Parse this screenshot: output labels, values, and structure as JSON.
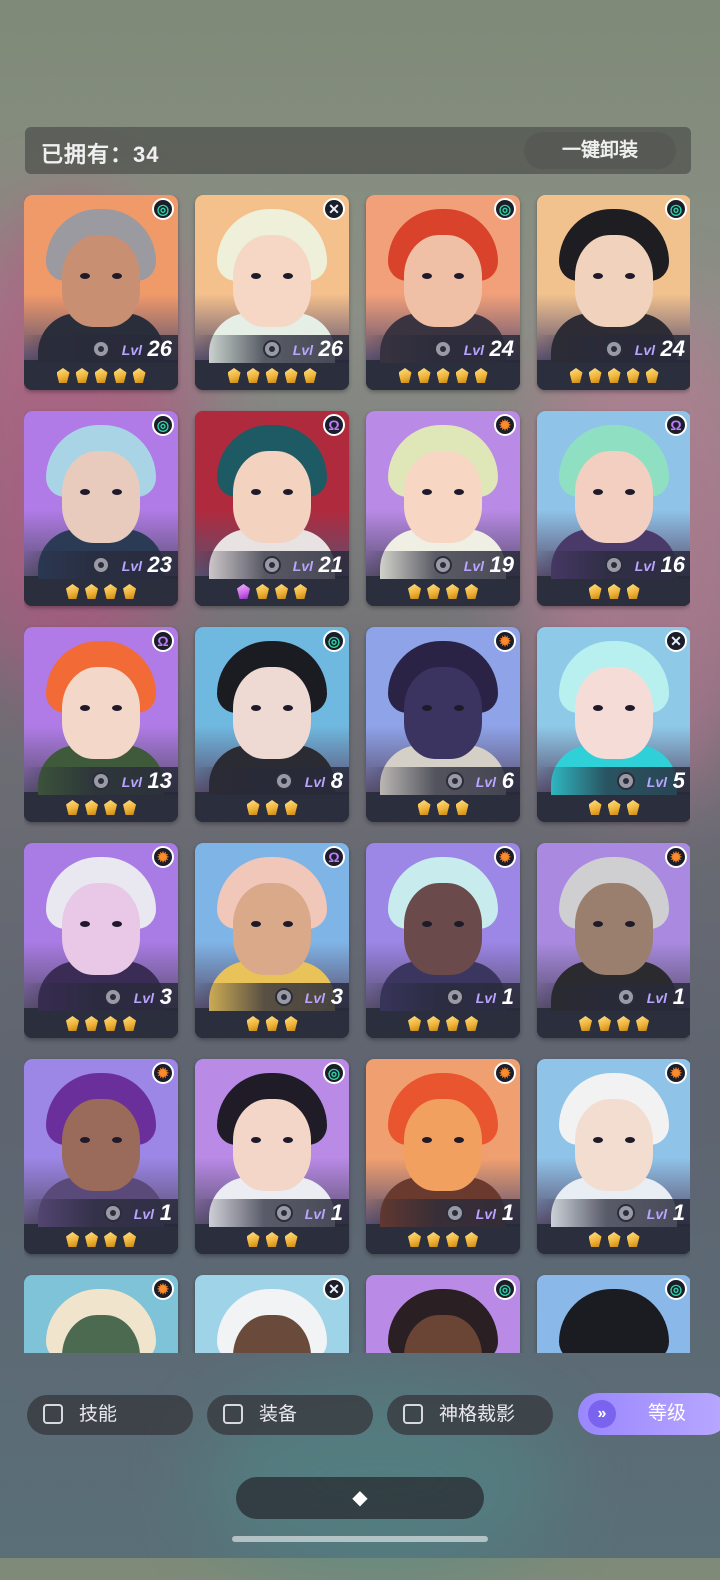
{
  "header": {
    "owned_label": "已拥有：34",
    "unequip_label": "一键卸装"
  },
  "characters": [
    {
      "level": "26",
      "gems": 5,
      "purple": 0,
      "badge": "spiral",
      "badge_color": "#2fd3a8",
      "bg": "#f09a6a",
      "hair": "#9a9aa0",
      "skin": "#c98f72",
      "outfit": "#2a2d3a"
    },
    {
      "level": "26",
      "gems": 5,
      "purple": 0,
      "badge": "cross",
      "badge_color": "#e8f0ff",
      "bg": "#f4c08c",
      "hair": "#eef0da",
      "skin": "#f6d7c6",
      "outfit": "#e5efe6"
    },
    {
      "level": "24",
      "gems": 5,
      "purple": 0,
      "badge": "spiral",
      "badge_color": "#2fd3a8",
      "bg": "#f2a07a",
      "hair": "#d9432b",
      "skin": "#f0c0a6",
      "outfit": "#3a3440"
    },
    {
      "level": "24",
      "gems": 5,
      "purple": 0,
      "badge": "spiral",
      "badge_color": "#2fd3a8",
      "bg": "#f2c28e",
      "hair": "#1e1d22",
      "skin": "#f0d2bd",
      "outfit": "#2d2c35"
    },
    {
      "level": "23",
      "gems": 4,
      "purple": 0,
      "badge": "spiral",
      "badge_color": "#2fd3a8",
      "bg": "#b07be6",
      "hair": "#a9d4e6",
      "skin": "#e8cbbd",
      "outfit": "#2b3a55"
    },
    {
      "level": "21",
      "gems": 3,
      "purple": 1,
      "badge": "omega",
      "badge_color": "#c07cff",
      "bg": "#b02a3e",
      "hair": "#1d5a63",
      "skin": "#f3d2c0",
      "outfit": "#e9e2e2"
    },
    {
      "level": "19",
      "gems": 4,
      "purple": 0,
      "badge": "sun",
      "badge_color": "#ff8a2a",
      "bg": "#b98ae6",
      "hair": "#dfe6b8",
      "skin": "#f7d6c4",
      "outfit": "#f0efe4"
    },
    {
      "level": "16",
      "gems": 3,
      "purple": 0,
      "badge": "omega",
      "badge_color": "#c07cff",
      "bg": "#8fc3e8",
      "hair": "#8fe0c2",
      "skin": "#f2cfc0",
      "outfit": "#4a3a6a"
    },
    {
      "level": "13",
      "gems": 4,
      "purple": 0,
      "badge": "omega",
      "badge_color": "#c07cff",
      "bg": "#b07be6",
      "hair": "#f26a35",
      "skin": "#f3d7c8",
      "outfit": "#3f5a3a"
    },
    {
      "level": "8",
      "gems": 3,
      "purple": 0,
      "badge": "spiral",
      "badge_color": "#2fd3a8",
      "bg": "#6fb8e0",
      "hair": "#1b1b22",
      "skin": "#eed9d3",
      "outfit": "#2b2b33"
    },
    {
      "level": "6",
      "gems": 3,
      "purple": 0,
      "badge": "sun",
      "badge_color": "#ff8a2a",
      "bg": "#8ea3e8",
      "hair": "#2a2345",
      "skin": "#3b3360",
      "outfit": "#d4d0c8"
    },
    {
      "level": "5",
      "gems": 3,
      "purple": 0,
      "badge": "cross",
      "badge_color": "#e8f0ff",
      "bg": "#8fc9e8",
      "hair": "#b8f0f0",
      "skin": "#f6dcd6",
      "outfit": "#2fd0d8"
    },
    {
      "level": "3",
      "gems": 4,
      "purple": 0,
      "badge": "sun",
      "badge_color": "#ff8a2a",
      "bg": "#a97be4",
      "hair": "#e9e8f0",
      "skin": "#e8c8e6",
      "outfit": "#3a2c55"
    },
    {
      "level": "3",
      "gems": 3,
      "purple": 0,
      "badge": "omega",
      "badge_color": "#c07cff",
      "bg": "#7fb4e6",
      "hair": "#f0c7b8",
      "skin": "#d9a98a",
      "outfit": "#e9c25a"
    },
    {
      "level": "1",
      "gems": 4,
      "purple": 0,
      "badge": "sun",
      "badge_color": "#ff8a2a",
      "bg": "#9c86e6",
      "hair": "#c8ecee",
      "skin": "#6a4a4a",
      "outfit": "#3a3660"
    },
    {
      "level": "1",
      "gems": 4,
      "purple": 0,
      "badge": "sun",
      "badge_color": "#ff8a2a",
      "bg": "#a98ae0",
      "hair": "#cfcfd2",
      "skin": "#9b7f6e",
      "outfit": "#2a2a2f"
    },
    {
      "level": "1",
      "gems": 4,
      "purple": 0,
      "badge": "sun",
      "badge_color": "#ff8a2a",
      "bg": "#9c86e6",
      "hair": "#6a2f9a",
      "skin": "#9a6a5a",
      "outfit": "#5a4a7a"
    },
    {
      "level": "1",
      "gems": 3,
      "purple": 0,
      "badge": "spiral",
      "badge_color": "#2fd3a8",
      "bg": "#b98ae6",
      "hair": "#1f1c28",
      "skin": "#f3d6c8",
      "outfit": "#ecedf2"
    },
    {
      "level": "1",
      "gems": 4,
      "purple": 0,
      "badge": "sun",
      "badge_color": "#ff8a2a",
      "bg": "#f0a070",
      "hair": "#e8552e",
      "skin": "#f2a060",
      "outfit": "#6a3a2e"
    },
    {
      "level": "1",
      "gems": 3,
      "purple": 0,
      "badge": "sun",
      "badge_color": "#ff8a2a",
      "bg": "#8fc3e8",
      "hair": "#f2f2f2",
      "skin": "#f3ddd0",
      "outfit": "#e9eef4"
    },
    {
      "level": "",
      "gems": 0,
      "purple": 0,
      "badge": "sun",
      "badge_color": "#ff8a2a",
      "bg": "#7fc3d8",
      "hair": "#f0e4cc",
      "skin": "#4b6a50",
      "outfit": "#c83a2a"
    },
    {
      "level": "",
      "gems": 0,
      "purple": 0,
      "badge": "cross",
      "badge_color": "#e8f0ff",
      "bg": "#9fd4e8",
      "hair": "#f1f3f4",
      "skin": "#6a4a3a",
      "outfit": "#d8e4ea"
    },
    {
      "level": "",
      "gems": 0,
      "purple": 0,
      "badge": "spiral",
      "badge_color": "#2fd3a8",
      "bg": "#b98ae6",
      "hair": "#2a1f22",
      "skin": "#6a4536",
      "outfit": "#3a2a30"
    },
    {
      "level": "",
      "gems": 0,
      "purple": 0,
      "badge": "spiral",
      "badge_color": "#2fd3a8",
      "bg": "#8ab8e8",
      "hair": "#1b1c22",
      "skin": "#1b1c22",
      "outfit": "#1b1c22"
    }
  ],
  "level_prefix": "Lvl",
  "filters": {
    "skill": "技能",
    "equip": "装备",
    "divine": "神格裁影"
  },
  "sort": {
    "label": "等级",
    "icon": "double-chevron-down-icon"
  },
  "center_button": {
    "icon": "diamond-cluster-icon",
    "glyph": "◆"
  }
}
